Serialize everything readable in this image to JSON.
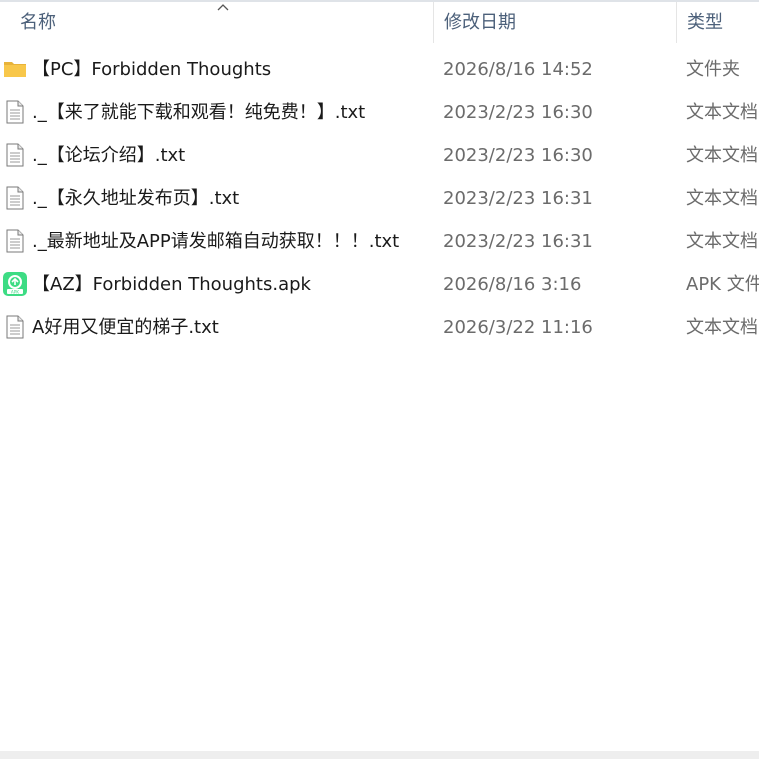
{
  "columns": {
    "name": "名称",
    "date": "修改日期",
    "type": "类型"
  },
  "files": [
    {
      "name": "【PC】Forbidden Thoughts",
      "date": "2026/8/16 14:52",
      "type": "文件夹",
      "icon": "folder-icon"
    },
    {
      "name": "._【来了就能下载和观看！纯免费！】.txt",
      "date": "2023/2/23 16:30",
      "type": "文本文档",
      "icon": "text-file-icon"
    },
    {
      "name": "._【论坛介绍】.txt",
      "date": "2023/2/23 16:30",
      "type": "文本文档",
      "icon": "text-file-icon"
    },
    {
      "name": "._【永久地址发布页】.txt",
      "date": "2023/2/23 16:31",
      "type": "文本文档",
      "icon": "text-file-icon"
    },
    {
      "name": "._最新地址及APP请发邮箱自动获取！！！.txt",
      "date": "2023/2/23 16:31",
      "type": "文本文档",
      "icon": "text-file-icon"
    },
    {
      "name": "【AZ】Forbidden Thoughts.apk",
      "date": "2026/8/16 3:16",
      "type": "APK 文件",
      "icon": "apk-file-icon"
    },
    {
      "name": "A好用又便宜的梯子.txt",
      "date": "2026/3/22 11:16",
      "type": "文本文档",
      "icon": "text-file-icon"
    }
  ],
  "colors": {
    "folder": "#f8c74a",
    "apk": "#3ddc84",
    "header_text": "#4c607a"
  }
}
